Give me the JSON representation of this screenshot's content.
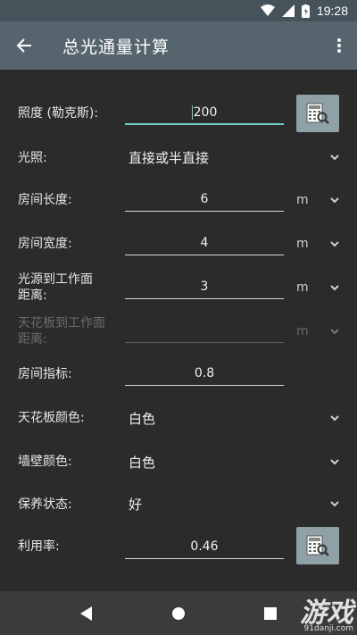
{
  "status": {
    "time": "19:28"
  },
  "appbar": {
    "title": "总光通量计算"
  },
  "form": {
    "illuminance": {
      "label": "照度 (勒克斯):",
      "value": "200"
    },
    "lighting": {
      "label": "光照:",
      "value": "直接或半直接"
    },
    "room_length": {
      "label": "房间长度:",
      "value": "6",
      "unit": "m"
    },
    "room_width": {
      "label": "房间宽度:",
      "value": "4",
      "unit": "m"
    },
    "light_to_work": {
      "label_line1": "光源到工作面",
      "label_line2": "距离:",
      "value": "3",
      "unit": "m"
    },
    "ceiling_to_work": {
      "label_line1": "天花板到工作面",
      "label_line2": "距离:",
      "value": "",
      "unit": "m"
    },
    "room_index": {
      "label": "房间指标:",
      "value": "0.8"
    },
    "ceiling_color": {
      "label": "天花板颜色:",
      "value": "白色"
    },
    "wall_color": {
      "label": "墙壁颜色:",
      "value": "白色"
    },
    "maintenance": {
      "label": "保养状态:",
      "value": "好"
    },
    "utilization": {
      "label": "利用率:",
      "value": "0.46"
    }
  },
  "watermark": {
    "brand": "游戏",
    "site": "91danji.com"
  },
  "icons": [
    "wifi-icon",
    "signal-icon",
    "battery-icon",
    "back-arrow-icon",
    "more-vert-icon",
    "chevron-down-icon",
    "calculator-icon",
    "nav-back-icon",
    "nav-home-icon",
    "nav-recents-icon"
  ]
}
